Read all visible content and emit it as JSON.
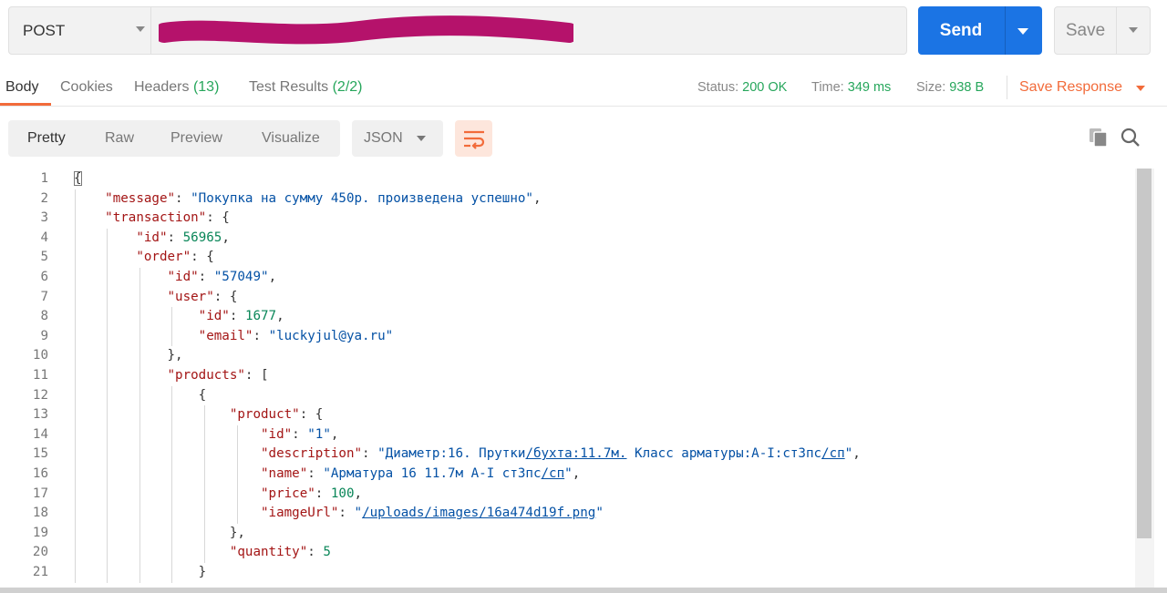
{
  "request": {
    "method": "POST",
    "send_label": "Send",
    "save_label": "Save",
    "redaction_color": "#b5126b"
  },
  "response_tabs": {
    "body": "Body",
    "cookies": "Cookies",
    "headers_label": "Headers",
    "headers_count": "(13)",
    "tests_label": "Test Results",
    "tests_count": "(2/2)"
  },
  "status": {
    "status_label": "Status:",
    "status_value": "200 OK",
    "time_label": "Time:",
    "time_value": "349 ms",
    "size_label": "Size:",
    "size_value": "938 B",
    "save_response": "Save Response"
  },
  "viewer": {
    "tabs": [
      "Pretty",
      "Raw",
      "Preview",
      "Visualize"
    ],
    "format": "JSON",
    "icons": [
      "wrap-lines-icon",
      "copy-icon",
      "search-icon"
    ]
  },
  "colors": {
    "accent": "#f26b3a",
    "send": "#1b74e4",
    "success": "#26a65b",
    "json_key": "#a31515",
    "json_string": "#0451a5",
    "json_number": "#098658"
  },
  "code_lines": [
    {
      "num": "1",
      "parts": [
        [
          "p",
          "{"
        ]
      ]
    },
    {
      "num": "2",
      "parts": [
        [
          "p",
          "    "
        ],
        [
          "k",
          "\"message\""
        ],
        [
          "p",
          ": "
        ],
        [
          "s",
          "\"Покупка на сумму 450р. произведена успешно\""
        ],
        [
          "p",
          ","
        ]
      ]
    },
    {
      "num": "3",
      "parts": [
        [
          "p",
          "    "
        ],
        [
          "k",
          "\"transaction\""
        ],
        [
          "p",
          ": {"
        ]
      ]
    },
    {
      "num": "4",
      "parts": [
        [
          "p",
          "        "
        ],
        [
          "k",
          "\"id\""
        ],
        [
          "p",
          ": "
        ],
        [
          "n",
          "56965"
        ],
        [
          "p",
          ","
        ]
      ]
    },
    {
      "num": "5",
      "parts": [
        [
          "p",
          "        "
        ],
        [
          "k",
          "\"order\""
        ],
        [
          "p",
          ": {"
        ]
      ]
    },
    {
      "num": "6",
      "parts": [
        [
          "p",
          "            "
        ],
        [
          "k",
          "\"id\""
        ],
        [
          "p",
          ": "
        ],
        [
          "s",
          "\"57049\""
        ],
        [
          "p",
          ","
        ]
      ]
    },
    {
      "num": "7",
      "parts": [
        [
          "p",
          "            "
        ],
        [
          "k",
          "\"user\""
        ],
        [
          "p",
          ": {"
        ]
      ]
    },
    {
      "num": "8",
      "parts": [
        [
          "p",
          "                "
        ],
        [
          "k",
          "\"id\""
        ],
        [
          "p",
          ": "
        ],
        [
          "n",
          "1677"
        ],
        [
          "p",
          ","
        ]
      ]
    },
    {
      "num": "9",
      "parts": [
        [
          "p",
          "                "
        ],
        [
          "k",
          "\"email\""
        ],
        [
          "p",
          ": "
        ],
        [
          "s",
          "\"luckyjul@ya.ru\""
        ]
      ]
    },
    {
      "num": "10",
      "parts": [
        [
          "p",
          "            },"
        ]
      ]
    },
    {
      "num": "11",
      "parts": [
        [
          "p",
          "            "
        ],
        [
          "k",
          "\"products\""
        ],
        [
          "p",
          ": ["
        ]
      ]
    },
    {
      "num": "12",
      "parts": [
        [
          "p",
          "                {"
        ]
      ]
    },
    {
      "num": "13",
      "parts": [
        [
          "p",
          "                    "
        ],
        [
          "k",
          "\"product\""
        ],
        [
          "p",
          ": {"
        ]
      ]
    },
    {
      "num": "14",
      "parts": [
        [
          "p",
          "                        "
        ],
        [
          "k",
          "\"id\""
        ],
        [
          "p",
          ": "
        ],
        [
          "s",
          "\"1\""
        ],
        [
          "p",
          ","
        ]
      ]
    },
    {
      "num": "15",
      "parts": [
        [
          "p",
          "                        "
        ],
        [
          "k",
          "\"description\""
        ],
        [
          "p",
          ": "
        ],
        [
          "s",
          "\"Диаметр:16. Прутки"
        ],
        [
          "su",
          "/бухта:11.7м."
        ],
        [
          "s",
          " Класс арматуры:А-I:ст3пс"
        ],
        [
          "su",
          "/сп"
        ],
        [
          "s",
          "\""
        ],
        [
          "p",
          ","
        ]
      ]
    },
    {
      "num": "16",
      "parts": [
        [
          "p",
          "                        "
        ],
        [
          "k",
          "\"name\""
        ],
        [
          "p",
          ": "
        ],
        [
          "s",
          "\"Арматура 16 11.7м А-I ст3пс"
        ],
        [
          "su",
          "/сп"
        ],
        [
          "s",
          "\""
        ],
        [
          "p",
          ","
        ]
      ]
    },
    {
      "num": "17",
      "parts": [
        [
          "p",
          "                        "
        ],
        [
          "k",
          "\"price\""
        ],
        [
          "p",
          ": "
        ],
        [
          "n",
          "100"
        ],
        [
          "p",
          ","
        ]
      ]
    },
    {
      "num": "18",
      "parts": [
        [
          "p",
          "                        "
        ],
        [
          "k",
          "\"iamgeUrl\""
        ],
        [
          "p",
          ": "
        ],
        [
          "s",
          "\""
        ],
        [
          "su",
          "/uploads/images/16a474d19f.png"
        ],
        [
          "s",
          "\""
        ]
      ]
    },
    {
      "num": "19",
      "parts": [
        [
          "p",
          "                    },"
        ]
      ]
    },
    {
      "num": "20",
      "parts": [
        [
          "p",
          "                    "
        ],
        [
          "k",
          "\"quantity\""
        ],
        [
          "p",
          ": "
        ],
        [
          "n",
          "5"
        ]
      ]
    },
    {
      "num": "21",
      "parts": [
        [
          "p",
          "                }"
        ]
      ]
    }
  ]
}
